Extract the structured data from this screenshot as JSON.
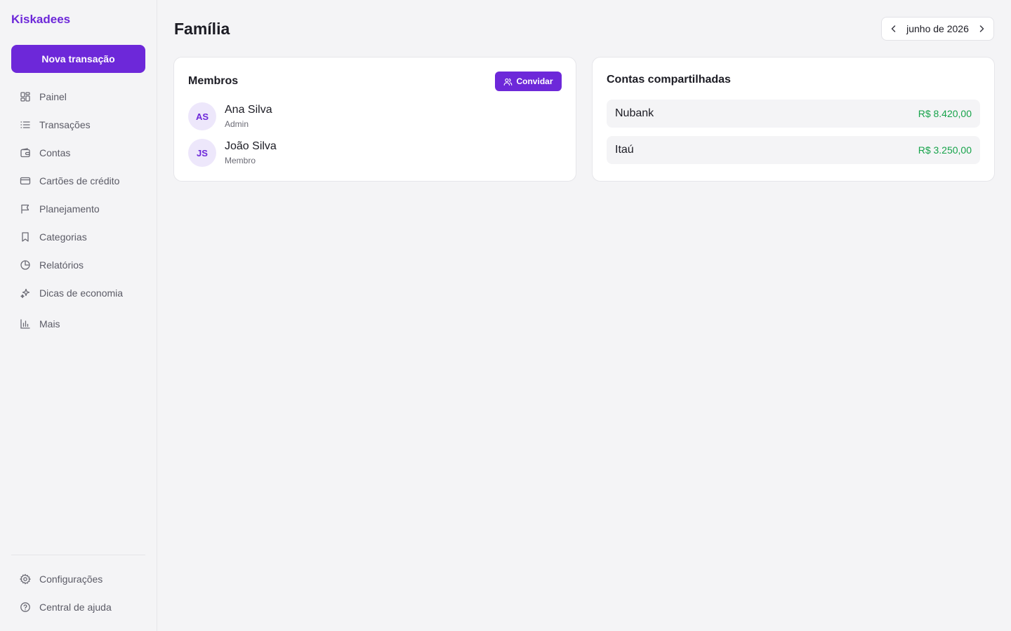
{
  "app": {
    "name": "Kiskadees"
  },
  "sidebar": {
    "new_transaction_label": "Nova transação",
    "items": [
      {
        "label": "Painel",
        "icon": "dashboard-icon"
      },
      {
        "label": "Transações",
        "icon": "list-icon"
      },
      {
        "label": "Contas",
        "icon": "wallet-icon"
      },
      {
        "label": "Cartões de crédito",
        "icon": "credit-card-icon"
      },
      {
        "label": "Planejamento",
        "icon": "flag-icon"
      },
      {
        "label": "Categorias",
        "icon": "bookmark-icon"
      },
      {
        "label": "Relatórios",
        "icon": "pie-chart-icon"
      },
      {
        "label": "Dicas de economia",
        "icon": "sparkles-icon"
      },
      {
        "label": "Mais",
        "icon": "bar-chart-icon"
      }
    ],
    "footer_items": [
      {
        "label": "Configurações",
        "icon": "gear-icon"
      },
      {
        "label": "Central de ajuda",
        "icon": "help-circle-icon"
      }
    ]
  },
  "header": {
    "title": "Família",
    "month": "junho de 2026"
  },
  "members_card": {
    "title": "Membros",
    "invite_label": "Convidar",
    "members": [
      {
        "initials": "AS",
        "name": "Ana Silva",
        "role": "Admin"
      },
      {
        "initials": "JS",
        "name": "João Silva",
        "role": "Membro"
      }
    ]
  },
  "accounts_card": {
    "title": "Contas compartilhadas",
    "accounts": [
      {
        "name": "Nubank",
        "balance": "R$ 8.420,00"
      },
      {
        "name": "Itaú",
        "balance": "R$ 3.250,00"
      }
    ]
  },
  "colors": {
    "accent": "#6d28d9",
    "positive": "#16a34a",
    "background": "#f4f4f6"
  }
}
